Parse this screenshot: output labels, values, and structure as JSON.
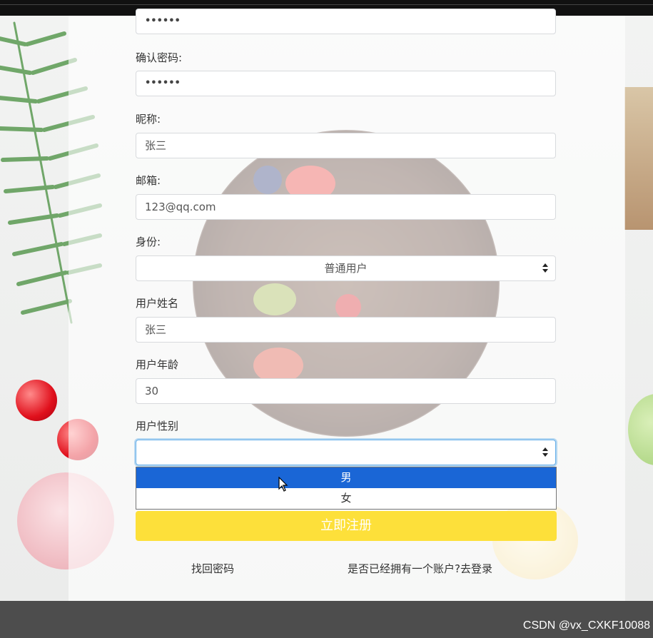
{
  "form": {
    "password_value": "••••••",
    "confirm_label": "确认密码:",
    "confirm_value": "••••••",
    "nickname_label": "昵称:",
    "nickname_value": "张三",
    "email_label": "邮箱:",
    "email_value": "123@qq.com",
    "role_label": "身份:",
    "role_value": "普通用户",
    "username_label": "用户姓名",
    "username_value": "张三",
    "age_label": "用户年龄",
    "age_value": "30",
    "gender_label": "用户性别",
    "gender_value": "",
    "gender_options": [
      "男",
      "女"
    ],
    "submit_label": "立即注册",
    "forgot_link": "找回密码",
    "login_link": "是否已经拥有一个账户?去登录"
  },
  "watermark": "CSDN @vx_CXKF10088",
  "colors": {
    "submit_bg": "#fde03a",
    "option_highlight": "#1a66d6",
    "footer_bg": "#4d4d4d"
  }
}
